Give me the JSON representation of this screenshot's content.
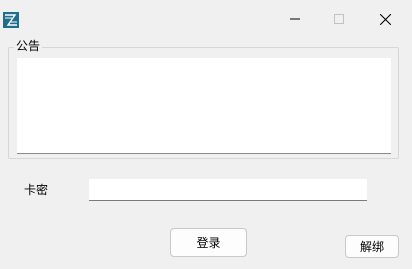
{
  "window": {
    "app_icon": "app-logo-icon",
    "caption_buttons": {
      "minimize": "minimize-icon",
      "maximize": "maximize-icon",
      "close": "close-icon"
    }
  },
  "notice": {
    "label": "公告",
    "content": ""
  },
  "card": {
    "label": "卡密",
    "value": ""
  },
  "buttons": {
    "login": "登录",
    "unbind": "解绑"
  },
  "colors": {
    "window_bg": "#f0f0f0",
    "app_icon": "#1e6f8c"
  }
}
